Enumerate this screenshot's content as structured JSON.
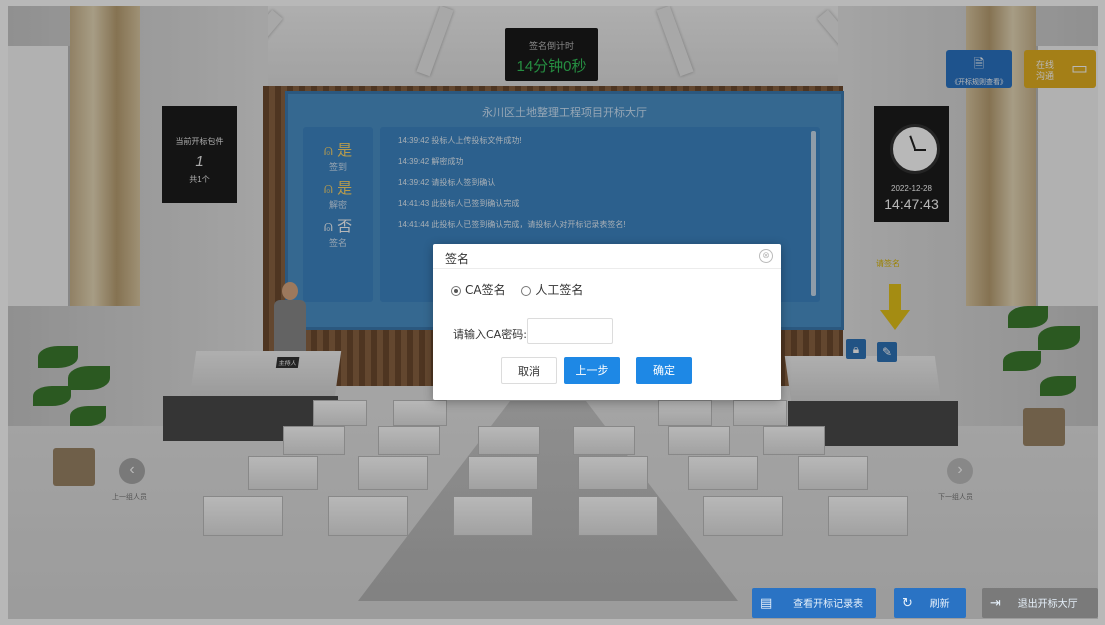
{
  "timer": {
    "label": "签名倒计时",
    "value": "14分钟0秒"
  },
  "screen": {
    "title": "永川区土地整理工程项目开标大厅",
    "status": [
      {
        "mark": "是",
        "label": "签到"
      },
      {
        "mark": "是",
        "label": "解密"
      },
      {
        "mark": "否",
        "label": "签名"
      }
    ],
    "log": [
      "14:39:42 投标人上传投标文件成功!",
      "14:39:42 解密成功",
      "14:39:42 请投标人签到确认",
      "14:41:43 此投标人已签到确认完成",
      "14:41:44 此投标人已签到确认完成，请投标人对开标记录表签名!"
    ]
  },
  "left_board": {
    "title": "当前开标包件",
    "number": "1",
    "total": "共1个"
  },
  "clock": {
    "date": "2022-12-28",
    "time": "14:47:43"
  },
  "podium_label": "主持人",
  "sign_tip": "请签名",
  "top_buttons": {
    "rules": "《开标规则查看》",
    "chat": "在线沟通"
  },
  "nav": {
    "prev": "上一组人员",
    "next": "下一组人员"
  },
  "bottom_buttons": {
    "record": "查看开标记录表",
    "refresh": "刷新",
    "exit": "退出开标大厅"
  },
  "dialog": {
    "title": "签名",
    "close": "⊗",
    "options": [
      "CA签名",
      "人工签名"
    ],
    "selected": "CA签名",
    "password_label": "请输入CA密码:",
    "password_value": "",
    "cancel": "取消",
    "prev": "上一步",
    "confirm": "确定"
  },
  "colors": {
    "accent": "#1e88e5",
    "timer_green": "#34c45a",
    "dialog_blue": "#1e88e5"
  }
}
